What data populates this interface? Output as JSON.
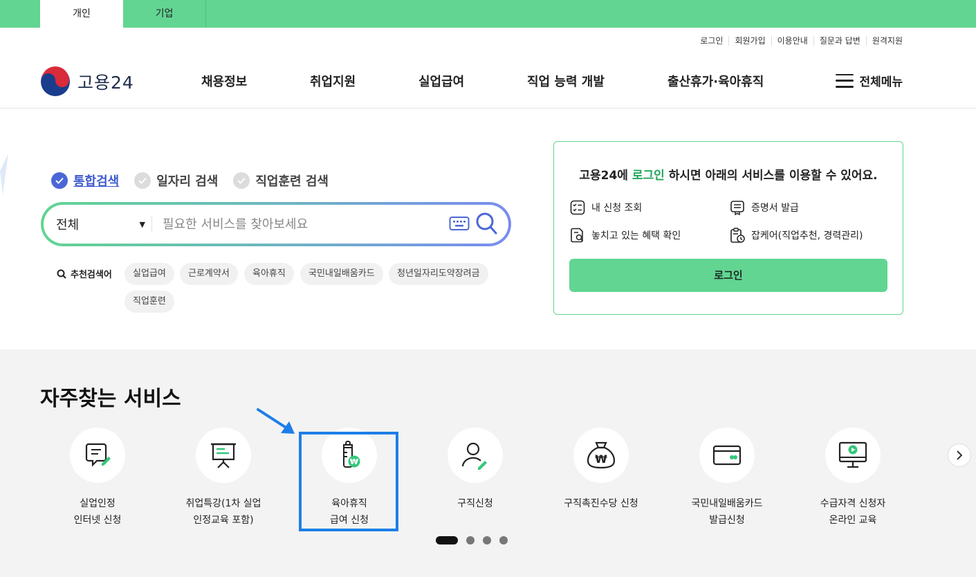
{
  "top_tabs": [
    {
      "label": "개인",
      "active": true
    },
    {
      "label": "기업",
      "active": false
    }
  ],
  "util_links": [
    "로그인",
    "회원가입",
    "이용안내",
    "질문과 답변",
    "원격지원"
  ],
  "logo": {
    "text": "고용24"
  },
  "gnb": [
    "채용정보",
    "취업지원",
    "실업급여",
    "직업 능력 개발",
    "출산휴가·육아휴직"
  ],
  "all_menu": {
    "label": "전체메뉴",
    "icon": "hamburger-icon"
  },
  "search": {
    "tabs": [
      {
        "label": "통합검색",
        "active": true
      },
      {
        "label": "일자리 검색",
        "active": false
      },
      {
        "label": "직업훈련 검색",
        "active": false
      }
    ],
    "scope": "전체",
    "placeholder": "필요한 서비스를 찾아보세요",
    "value": "",
    "recommend_label": "추천검색어",
    "keywords": [
      "실업급여",
      "근로계약서",
      "육아휴직",
      "국민내일배움카드",
      "청년일자리도약장려금",
      "직업훈련"
    ]
  },
  "login_card": {
    "title_pre": "고용24에 ",
    "title_hl": "로그인",
    "title_post": " 하시면 아래의 서비스를 이용할 수 있어요.",
    "services": [
      {
        "label": "내 신청 조회",
        "icon": "checklist-icon"
      },
      {
        "label": "증명서 발급",
        "icon": "certificate-icon"
      },
      {
        "label": "놓치고 있는 혜택 확인",
        "icon": "benefit-search-icon"
      },
      {
        "label": "잡케어(직업추천, 경력관리)",
        "icon": "jobcare-icon"
      }
    ],
    "button": "로그인"
  },
  "frequent": {
    "title": "자주찾는 서비스",
    "items": [
      {
        "label": "실업인정\n인터넷 신청",
        "icon": "document-pen-icon"
      },
      {
        "label": "취업특강(1차 실업\n인정교육 포함)",
        "icon": "presentation-board-icon"
      },
      {
        "label": "육아휴직\n급여 신청",
        "icon": "baby-bottle-won-icon",
        "highlighted": true
      },
      {
        "label": "구직신청",
        "icon": "person-pen-icon"
      },
      {
        "label": "구직촉진수당 신청",
        "icon": "money-bag-icon"
      },
      {
        "label": "국민내일배움카드\n발급신청",
        "icon": "card-icon"
      },
      {
        "label": "수급자격 신청자\n온라인 교육",
        "icon": "monitor-play-icon"
      }
    ],
    "pagination": {
      "pages": 4,
      "current": 1
    }
  },
  "colors": {
    "brand_green": "#62d592",
    "highlight_blue": "#1e7ee8",
    "active_tab_blue": "#3d5bd0"
  }
}
